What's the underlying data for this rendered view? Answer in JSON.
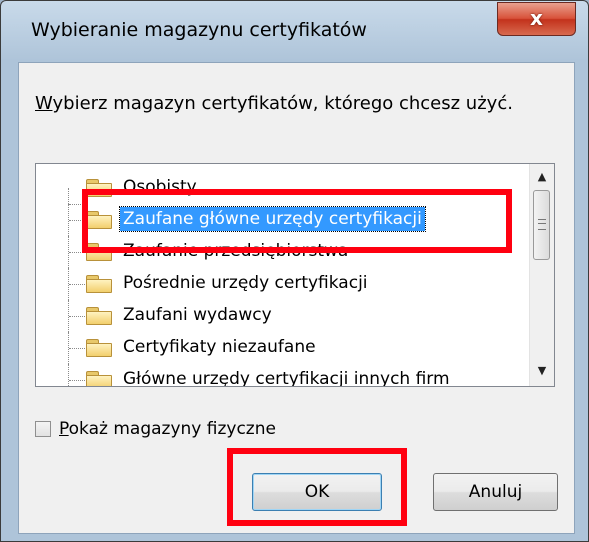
{
  "window": {
    "title": "Wybieranie magazynu certyfikatów",
    "close_label": "x"
  },
  "prompt": {
    "accel": "W",
    "text": "ybierz magazyn certyfikatów, którego chcesz użyć."
  },
  "stores": [
    {
      "label": "Osobisty",
      "selected": false
    },
    {
      "label": "Zaufane główne urzędy certyfikacji",
      "selected": true
    },
    {
      "label": "Zaufanie przedsiębiorstwa",
      "selected": false
    },
    {
      "label": "Pośrednie urzędy certyfikacji",
      "selected": false
    },
    {
      "label": "Zaufani wydawcy",
      "selected": false
    },
    {
      "label": "Certyfikaty niezaufane",
      "selected": false
    },
    {
      "label": "Główne urzędy certyfikacji innych firm",
      "selected": false
    }
  ],
  "scrollbar": {
    "up_glyph": "▲",
    "down_glyph": "▼"
  },
  "show_physical": {
    "accel": "P",
    "text": "okaż magazyny fizyczne",
    "checked": false
  },
  "buttons": {
    "ok": "OK",
    "cancel": "Anuluj"
  },
  "colors": {
    "selection": "#3399ff",
    "highlight": "#ff0010",
    "close": "#c3321c"
  }
}
